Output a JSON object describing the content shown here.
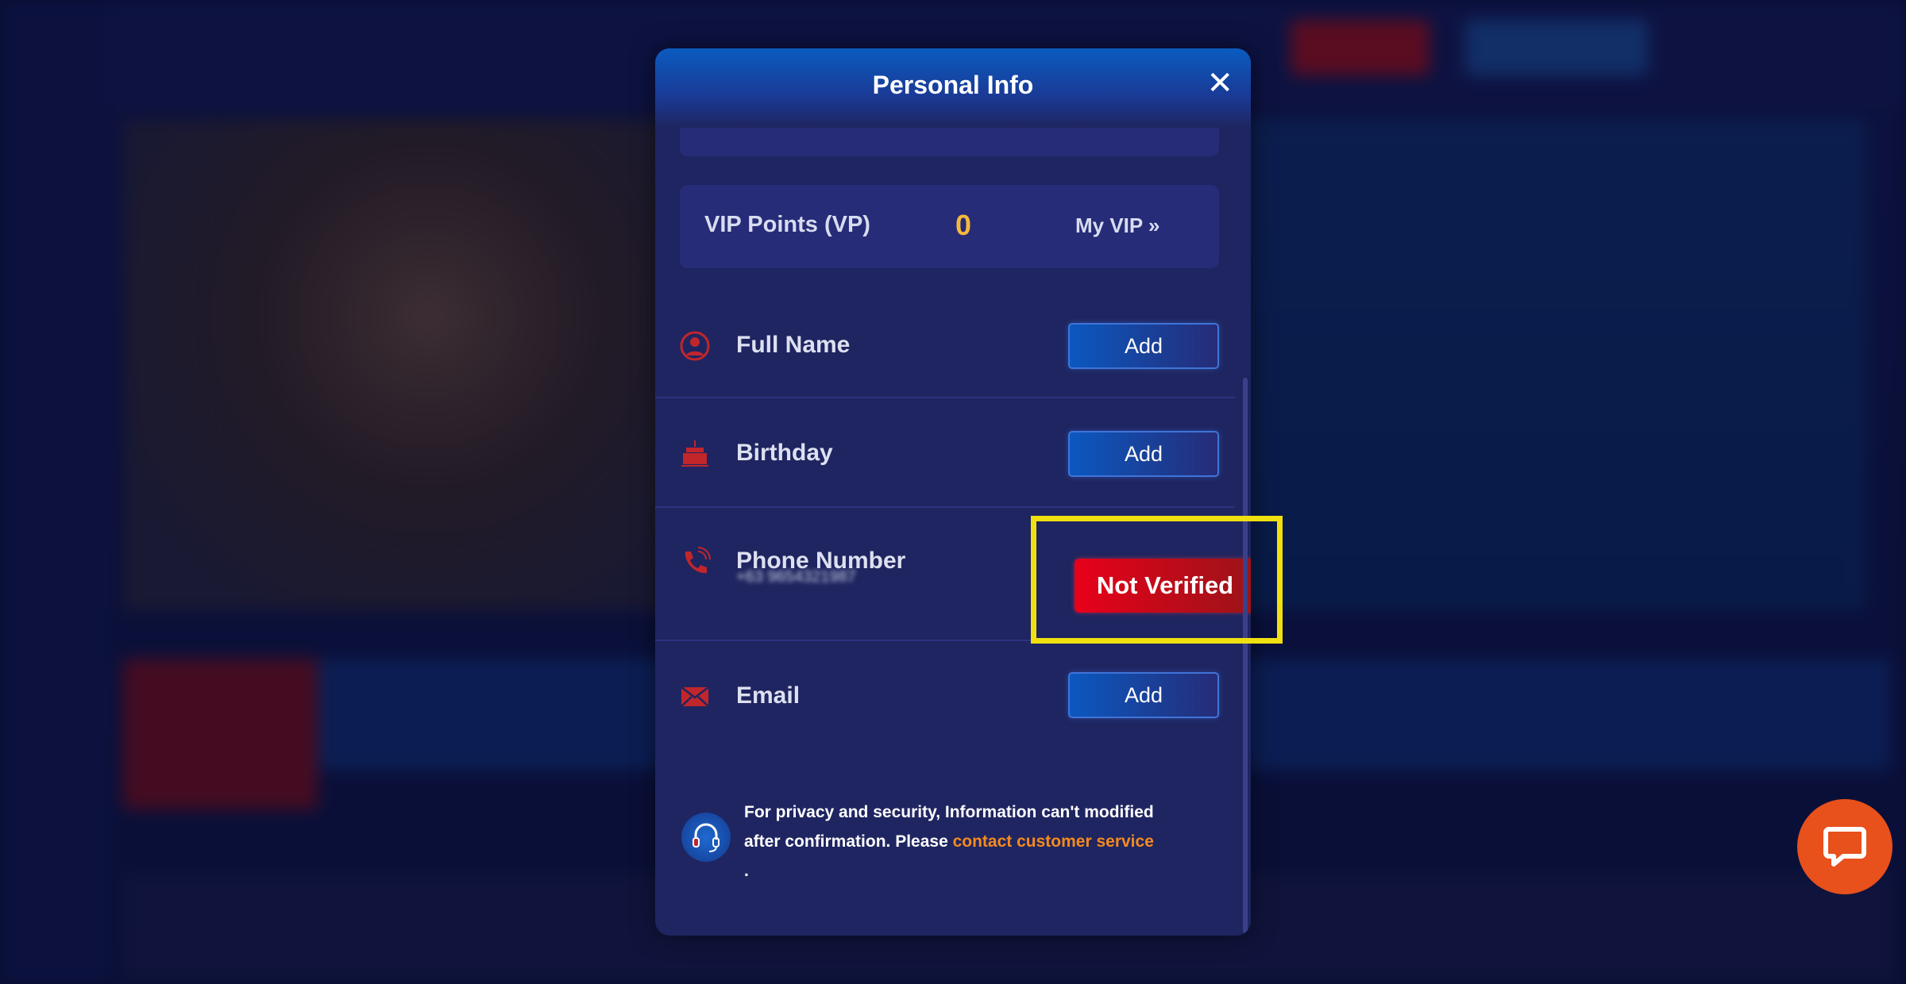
{
  "modal": {
    "title": "Personal Info",
    "close_icon": "close-icon",
    "vip": {
      "label": "VIP Points (VP)",
      "value": "0",
      "link": "My VIP »"
    },
    "fields": [
      {
        "label": "Full Name",
        "icon": "user-icon",
        "action": "Add"
      },
      {
        "label": "Birthday",
        "icon": "cake-icon",
        "action": "Add"
      },
      {
        "label": "Phone Number",
        "icon": "phone-icon",
        "value": "+63 9654321987",
        "status": "Not Verified"
      },
      {
        "label": "Email",
        "icon": "envelope-icon",
        "action": "Add"
      }
    ],
    "footer": {
      "text": "For privacy and security, Information can't modified after confirmation. Please ",
      "link": "contact customer service",
      "end": "."
    }
  },
  "colors": {
    "accent_red": "#e8001a",
    "link_orange": "#f58a1f",
    "vip_gold": "#f5b93a",
    "highlight": "#f0e010",
    "chat": "#e8501c"
  }
}
